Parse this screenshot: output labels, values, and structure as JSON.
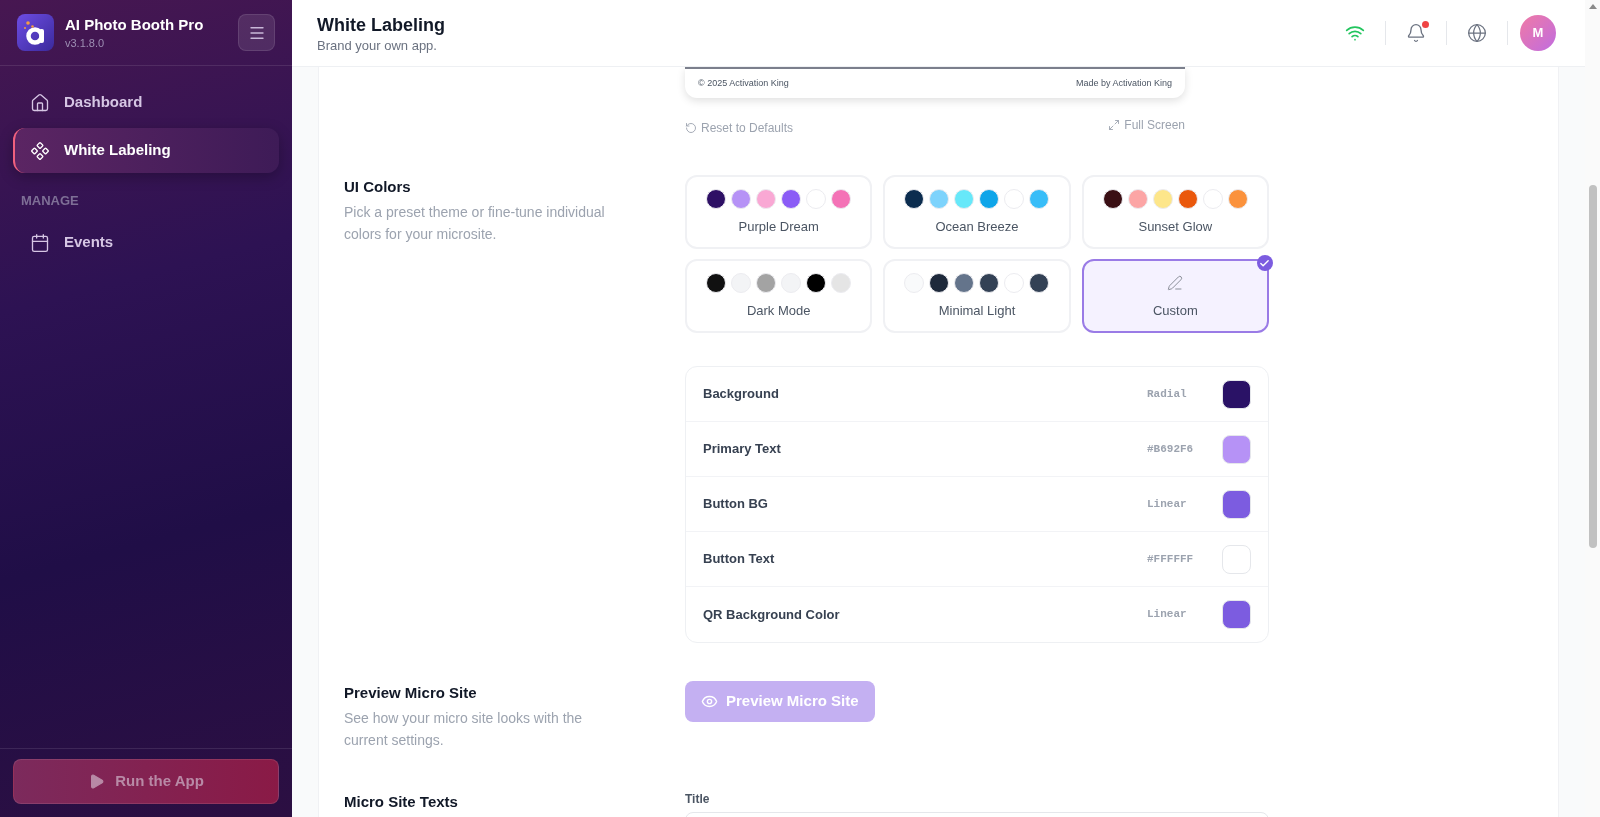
{
  "sidebar": {
    "app_name": "AI Photo Booth Pro",
    "version": "v3.1.8.0",
    "nav": [
      {
        "label": "Dashboard",
        "selected": false
      },
      {
        "label": "White Labeling",
        "selected": true
      }
    ],
    "sections": [
      {
        "title": "MANAGE",
        "items": [
          {
            "label": "Events",
            "selected": false
          }
        ]
      }
    ],
    "run_button": {
      "label": "Run the App",
      "disabled": true
    }
  },
  "header": {
    "title": "White Labeling",
    "subtitle": "Brand your own app.",
    "online": true,
    "unread_notifications": true,
    "avatar_initial": "M"
  },
  "preview": {
    "footer_left": "© 2025 Activation King",
    "footer_right": "Made by Activation King",
    "reset_label": "Reset to Defaults",
    "fullscreen_label": "Full Screen"
  },
  "ui_colors": {
    "title": "UI Colors",
    "description": "Pick a preset theme or fine-tune individual colors for your microsite.",
    "themes": [
      {
        "name": "Purple Dream",
        "kind": "preset",
        "selected": false,
        "swatches": [
          {
            "color": "#2e1065"
          },
          {
            "color": "#b692f6"
          },
          {
            "color": "#f9a8d4"
          },
          {
            "color": "#8b5cf6"
          },
          {
            "color": "#ffffff"
          },
          {
            "color": "#f472b6"
          }
        ]
      },
      {
        "name": "Ocean Breeze",
        "kind": "preset",
        "selected": false,
        "swatches": [
          {
            "color": "#0c2d4f"
          },
          {
            "color": "#7dd3fc"
          },
          {
            "color": "#67e8f9"
          },
          {
            "color": "#0ea5e9"
          },
          {
            "color": "#ffffff"
          },
          {
            "color": "#38bdf8"
          }
        ]
      },
      {
        "name": "Sunset Glow",
        "kind": "preset",
        "selected": false,
        "swatches": [
          {
            "color": "#3a0f14"
          },
          {
            "color": "#fca5a5"
          },
          {
            "color": "#fde68a"
          },
          {
            "color": "#ea580c"
          },
          {
            "color": "#ffffff"
          },
          {
            "color": "#fb923c"
          }
        ]
      },
      {
        "name": "Dark Mode",
        "kind": "preset",
        "selected": false,
        "swatches": [
          {
            "color": "#111111"
          },
          {
            "color": "#f3f4f6"
          },
          {
            "color": "#a3a3a3"
          },
          {
            "color": "#f3f4f6"
          },
          {
            "color": "#000000"
          },
          {
            "color": "#e5e5e5"
          }
        ]
      },
      {
        "name": "Minimal Light",
        "kind": "preset",
        "selected": false,
        "swatches": [
          {
            "color": "#f9fafb"
          },
          {
            "color": "#1e293b"
          },
          {
            "color": "#64748b"
          },
          {
            "color": "#334155"
          },
          {
            "color": "#ffffff"
          },
          {
            "color": "#334155"
          }
        ]
      },
      {
        "name": "Custom",
        "kind": "custom",
        "selected": true
      }
    ],
    "rows": [
      {
        "label": "Background",
        "value": "Radial",
        "color": "#2a1266"
      },
      {
        "label": "Primary Text",
        "value": "#B692F6",
        "color": "#b692f6"
      },
      {
        "label": "Button BG",
        "value": "Linear",
        "color": "#7c5ce0"
      },
      {
        "label": "Button Text",
        "value": "#FFFFFF",
        "color": "#ffffff"
      },
      {
        "label": "QR Background Color",
        "value": "Linear",
        "color": "#7c5ce0"
      }
    ]
  },
  "preview_section": {
    "title": "Preview Micro Site",
    "description": "See how your micro site looks with the current settings.",
    "button": {
      "label": "Preview Micro Site",
      "disabled": true
    }
  },
  "texts_section": {
    "title": "Micro Site Texts",
    "fields": [
      {
        "label": "Title"
      }
    ]
  }
}
